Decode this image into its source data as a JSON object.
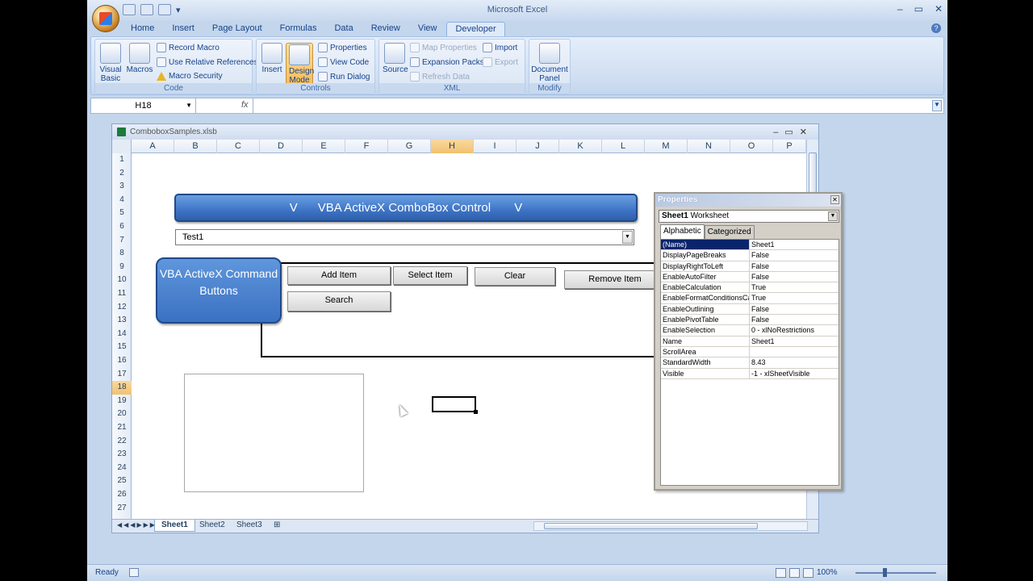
{
  "app": {
    "title": "Microsoft Excel",
    "tabs": [
      "Home",
      "Insert",
      "Page Layout",
      "Formulas",
      "Data",
      "Review",
      "View",
      "Developer"
    ],
    "active_tab": "Developer"
  },
  "ribbon": {
    "code": {
      "label": "Code",
      "visual_basic": "Visual Basic",
      "macros": "Macros",
      "record_macro": "Record Macro",
      "relative_refs": "Use Relative References",
      "macro_security": "Macro Security"
    },
    "controls": {
      "label": "Controls",
      "insert": "Insert",
      "design_mode": "Design Mode",
      "properties": "Properties",
      "view_code": "View Code",
      "run_dialog": "Run Dialog"
    },
    "xml": {
      "label": "XML",
      "source": "Source",
      "map_properties": "Map Properties",
      "expansion_packs": "Expansion Packs",
      "refresh_data": "Refresh Data",
      "import": "Import",
      "export": "Export"
    },
    "modify": {
      "label": "Modify",
      "document_panel": "Document Panel"
    }
  },
  "formula_bar": {
    "name_box": "H18",
    "fx": "fx",
    "value": ""
  },
  "workbook": {
    "title": "ComboboxSamples.xlsb",
    "columns": [
      "A",
      "B",
      "C",
      "D",
      "E",
      "F",
      "G",
      "H",
      "I",
      "J",
      "K",
      "L",
      "M",
      "N",
      "O",
      "P"
    ],
    "selected_column": "H",
    "rows": [
      "1",
      "2",
      "3",
      "4",
      "5",
      "6",
      "7",
      "8",
      "9",
      "10",
      "11",
      "12",
      "13",
      "14",
      "15",
      "16",
      "17",
      "18",
      "19",
      "20",
      "21",
      "22",
      "23",
      "24",
      "25",
      "26",
      "27"
    ],
    "selected_row": "18",
    "sheets": [
      "Sheet1",
      "Sheet2",
      "Sheet3"
    ],
    "active_sheet": "Sheet1"
  },
  "sheet_objects": {
    "banner": "V      VBA ActiveX ComboBox Control       V",
    "combo_value": "Test1",
    "command_box": "VBA ActiveX Command Buttons",
    "buttons": {
      "add_item": "Add Item",
      "select_item": "Select Item",
      "clear": "Clear",
      "remove_item": "Remove Item",
      "search": "Search"
    }
  },
  "properties_window": {
    "title": "Properties",
    "object": "Sheet1",
    "object_type": "Worksheet",
    "tabs": [
      "Alphabetic",
      "Categorized"
    ],
    "active_tab": "Alphabetic",
    "rows": [
      {
        "name": "(Name)",
        "value": "Sheet1"
      },
      {
        "name": "DisplayPageBreaks",
        "value": "False"
      },
      {
        "name": "DisplayRightToLeft",
        "value": "False"
      },
      {
        "name": "EnableAutoFilter",
        "value": "False"
      },
      {
        "name": "EnableCalculation",
        "value": "True"
      },
      {
        "name": "EnableFormatConditionsCal",
        "value": "True"
      },
      {
        "name": "EnableOutlining",
        "value": "False"
      },
      {
        "name": "EnablePivotTable",
        "value": "False"
      },
      {
        "name": "EnableSelection",
        "value": "0 - xlNoRestrictions"
      },
      {
        "name": "Name",
        "value": "Sheet1"
      },
      {
        "name": "ScrollArea",
        "value": ""
      },
      {
        "name": "StandardWidth",
        "value": "8.43"
      },
      {
        "name": "Visible",
        "value": "-1 - xlSheetVisible"
      }
    ]
  },
  "status_bar": {
    "ready": "Ready",
    "zoom": "100%"
  }
}
